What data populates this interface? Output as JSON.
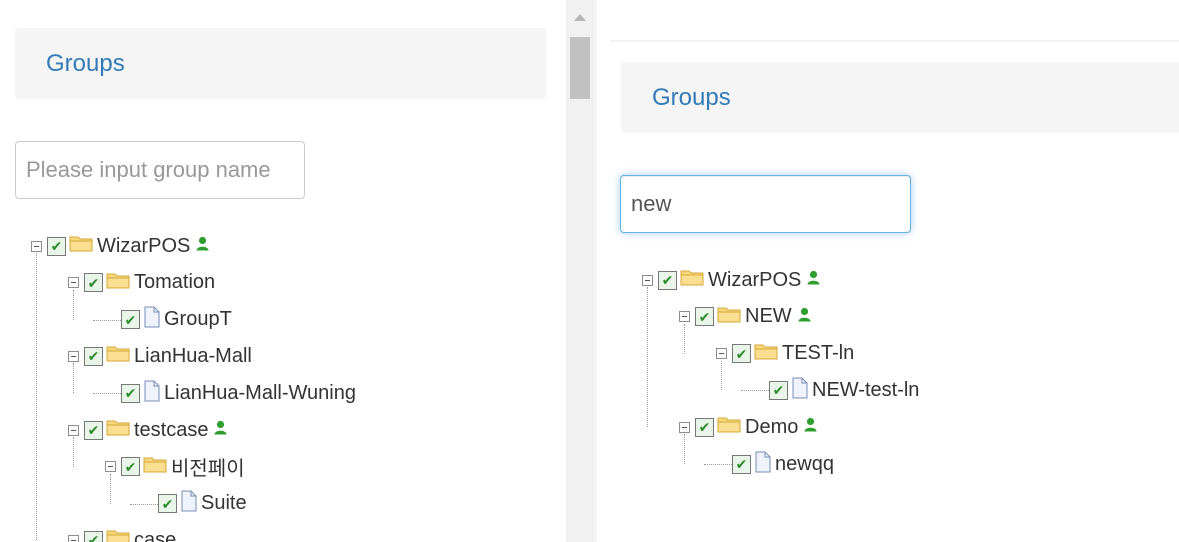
{
  "left_panel": {
    "heading": "Groups",
    "search": {
      "value": "",
      "placeholder": "Please input group name"
    },
    "tree": [
      {
        "label": "WizarPOS",
        "type": "folder",
        "level": 0,
        "expanded": true,
        "checked": true,
        "user_icon": true
      },
      {
        "label": "Tomation",
        "type": "folder",
        "level": 1,
        "expanded": true,
        "checked": true,
        "user_icon": false
      },
      {
        "label": "GroupT",
        "type": "file",
        "level": 2,
        "checked": true,
        "user_icon": false
      },
      {
        "label": "LianHua-Mall",
        "type": "folder",
        "level": 1,
        "expanded": true,
        "checked": true,
        "user_icon": false
      },
      {
        "label": "LianHua-Mall-Wuning",
        "type": "file",
        "level": 2,
        "checked": true,
        "user_icon": false
      },
      {
        "label": "testcase",
        "type": "folder",
        "level": 1,
        "expanded": true,
        "checked": true,
        "user_icon": true
      },
      {
        "label": "비전페이",
        "type": "folder",
        "level": 2,
        "expanded": true,
        "checked": true,
        "user_icon": false
      },
      {
        "label": "Suite",
        "type": "file",
        "level": 3,
        "checked": true,
        "user_icon": false
      },
      {
        "label": "case",
        "type": "folder",
        "level": 1,
        "expanded": true,
        "checked": true,
        "user_icon": false
      }
    ]
  },
  "right_panel": {
    "heading": "Groups",
    "search": {
      "value": "new",
      "placeholder": "Please input group name"
    },
    "tree": [
      {
        "label": "WizarPOS",
        "type": "folder",
        "level": 0,
        "expanded": true,
        "checked": true,
        "user_icon": true
      },
      {
        "label": "NEW",
        "type": "folder",
        "level": 1,
        "expanded": true,
        "checked": true,
        "user_icon": true
      },
      {
        "label": "TEST-ln",
        "type": "folder",
        "level": 2,
        "expanded": true,
        "checked": true,
        "user_icon": false
      },
      {
        "label": "NEW-test-ln",
        "type": "file",
        "level": 3,
        "checked": true,
        "user_icon": false
      },
      {
        "label": "Demo",
        "type": "folder",
        "level": 1,
        "expanded": true,
        "checked": true,
        "user_icon": true
      },
      {
        "label": "newqq",
        "type": "file",
        "level": 2,
        "checked": true,
        "user_icon": false
      }
    ]
  },
  "icons": {
    "check": "✔",
    "switch": "minus-box-icon",
    "folder": "folder-icon",
    "file": "file-icon",
    "user": "user-icon"
  },
  "colors": {
    "heading_text": "#337ab7",
    "heading_bg": "#f5f5f5",
    "focus_border": "#66afe9",
    "checkmark": "#2e8b2e",
    "folder": "#f5c85a",
    "user_icon": "#2e9e2e"
  }
}
